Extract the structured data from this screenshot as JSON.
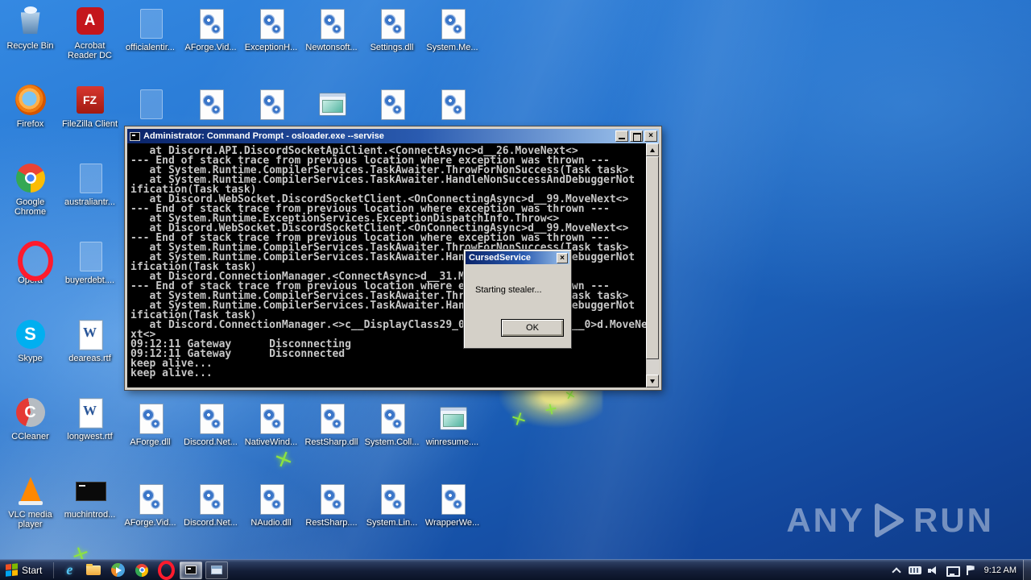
{
  "desktop": {
    "column1": [
      {
        "label": "Recycle Bin",
        "type": "recycle-bin"
      },
      {
        "label": "Firefox",
        "type": "firefox"
      },
      {
        "label": "Google Chrome",
        "type": "google-chrome"
      },
      {
        "label": "Opera",
        "type": "opera"
      },
      {
        "label": "Skype",
        "type": "skype"
      },
      {
        "label": "CCleaner",
        "type": "ccleaner"
      },
      {
        "label": "VLC media player",
        "type": "vlc"
      }
    ],
    "column2": [
      {
        "label": "Acrobat Reader DC",
        "type": "acrobat"
      },
      {
        "label": "FileZilla Client",
        "type": "filezilla"
      },
      {
        "label": "australiantr...",
        "type": "faint"
      },
      {
        "label": "buyerdebt....",
        "type": "faint"
      },
      {
        "label": "deareas.rtf",
        "type": "word-doc"
      },
      {
        "label": "longwest.rtf",
        "type": "word-doc"
      },
      {
        "label": "muchintrod...",
        "type": "black-rect"
      }
    ],
    "row_top": [
      {
        "label": "officialentir...",
        "type": "faint"
      },
      {
        "label": "AForge.Vid...",
        "type": "dll-gear"
      },
      {
        "label": "ExceptionH...",
        "type": "dll-gear"
      },
      {
        "label": "Newtonsoft...",
        "type": "dll-gear"
      },
      {
        "label": "Settings.dll",
        "type": "dll-gear"
      },
      {
        "label": "System.Me...",
        "type": "dll-gear"
      }
    ],
    "row_second": [
      {
        "label": "",
        "type": "faint"
      },
      {
        "label": "",
        "type": "dll-gear"
      },
      {
        "label": "",
        "type": "dll-gear"
      },
      {
        "label": "",
        "type": "window-app"
      },
      {
        "label": "",
        "type": "dll-gear"
      },
      {
        "label": "",
        "type": "dll-gear"
      }
    ],
    "row_third": [
      {
        "label": "AForge.dll",
        "type": "dll-gear"
      },
      {
        "label": "Discord.Net...",
        "type": "dll-gear"
      },
      {
        "label": "NativeWind...",
        "type": "dll-gear"
      },
      {
        "label": "RestSharp.dll",
        "type": "dll-gear"
      },
      {
        "label": "System.Coll...",
        "type": "dll-gear"
      },
      {
        "label": "winresume....",
        "type": "window-app"
      }
    ],
    "row_bottom": [
      {
        "label": "AForge.Vid...",
        "type": "dll-gear"
      },
      {
        "label": "Discord.Net...",
        "type": "dll-gear"
      },
      {
        "label": "NAudio.dll",
        "type": "dll-gear"
      },
      {
        "label": "RestSharp....",
        "type": "dll-gear"
      },
      {
        "label": "System.Lin...",
        "type": "dll-gear"
      },
      {
        "label": "WrapperWe...",
        "type": "dll-gear"
      }
    ]
  },
  "console_window": {
    "title": "Administrator: Command Prompt - osloader.exe --servise",
    "lines": [
      "   at Discord.API.DiscordSocketApiClient.<ConnectAsync>d__26.MoveNext<>",
      "--- End of stack trace from previous location where exception was thrown ---",
      "   at System.Runtime.CompilerServices.TaskAwaiter.ThrowForNonSuccess(Task task>",
      "   at System.Runtime.CompilerServices.TaskAwaiter.HandleNonSuccessAndDebuggerNot",
      "ification(Task task)",
      "   at Discord.WebSocket.DiscordSocketClient.<OnConnectingAsync>d__99.MoveNext<>",
      "--- End of stack trace from previous location where exception was thrown ---",
      "   at System.Runtime.ExceptionServices.ExceptionDispatchInfo.Throw<>",
      "   at Discord.WebSocket.DiscordSocketClient.<OnConnectingAsync>d__99.MoveNext<>",
      "--- End of stack trace from previous location where exception was thrown ---",
      "   at System.Runtime.CompilerServices.TaskAwaiter.ThrowForNonSuccess(Task task>",
      "   at System.Runtime.CompilerServices.TaskAwaiter.HandleNonSuccessAndDebuggerNot",
      "ification(Task task)",
      "   at Discord.ConnectionManager.<ConnectAsync>d__31.MoveNext<>",
      "--- End of stack trace from previous location where exception was thrown ---",
      "   at System.Runtime.CompilerServices.TaskAwaiter.ThrowForNonSuccess(Task task>",
      "   at System.Runtime.CompilerServices.TaskAwaiter.HandleNonSuccessAndDebuggerNot",
      "ification(Task task)",
      "   at Discord.ConnectionManager.<>c__DisplayClass29_0.<<ConnectAsync>b__0>d.MoveNe",
      "xt<>",
      "09:12:11 Gateway      Disconnecting",
      "09:12:11 Gateway      Disconnected",
      "keep alive...",
      "keep alive..."
    ]
  },
  "dialog": {
    "title": "CursedService",
    "message": "Starting stealer...",
    "ok_label": "OK",
    "close_glyph": "×"
  },
  "taskbar": {
    "start_label": "Start",
    "quick_launch": [
      "internet-explorer",
      "windows-explorer",
      "media-player",
      "chrome-small",
      "opera-small"
    ],
    "task_buttons": [
      "command-prompt",
      "cursed-service-dialog"
    ],
    "tray_icons": [
      "chevron-up",
      "keyboard",
      "volume",
      "network",
      "action-flag"
    ],
    "clock": "9:12 AM"
  },
  "watermark": {
    "left": "ANY",
    "right": "RUN"
  },
  "colors": {
    "title_bar_start": "#0a246a",
    "title_bar_end": "#a6caf0",
    "console_text": "#c7c7c7",
    "accent_red": "#ff1b2d"
  }
}
